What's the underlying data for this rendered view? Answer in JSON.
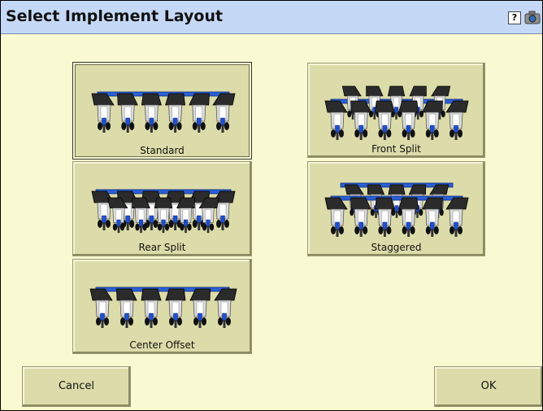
{
  "window": {
    "title": "Select Implement Layout"
  },
  "header": {
    "help_label": "?"
  },
  "layouts": [
    {
      "label": "Standard",
      "selected": true
    },
    {
      "label": "Front Split",
      "selected": false
    },
    {
      "label": "Rear Split",
      "selected": false
    },
    {
      "label": "Staggered",
      "selected": false
    },
    {
      "label": "Center Offset",
      "selected": false
    }
  ],
  "footer": {
    "cancel_label": "Cancel",
    "ok_label": "OK"
  },
  "colors": {
    "background": "#fafad2",
    "titlebar": "#c5d9f7",
    "button": "#dcdcaa",
    "toolbar_bar": "#2a5fd6",
    "unit_blue": "#1f4fcf"
  }
}
